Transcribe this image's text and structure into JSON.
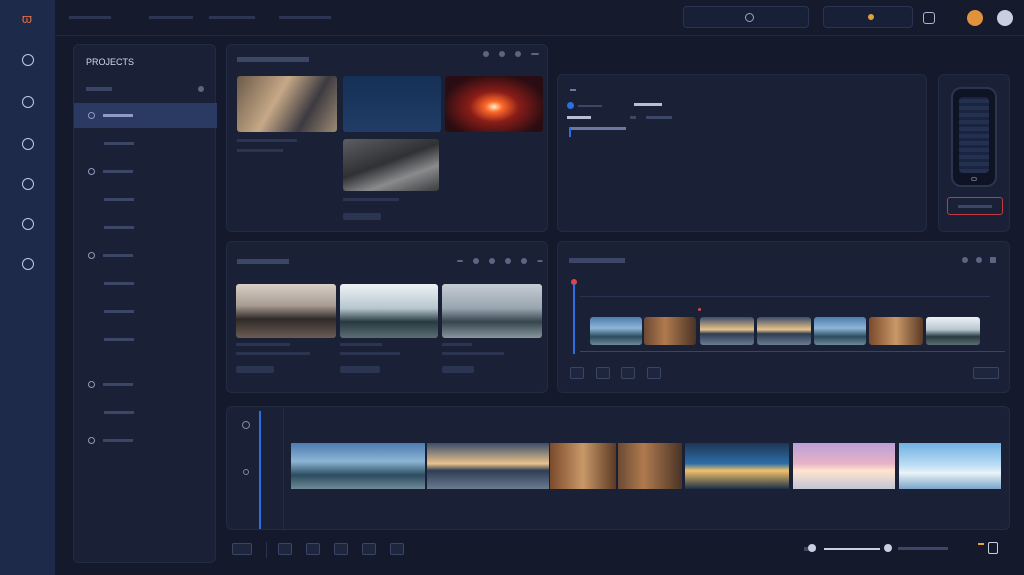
{
  "app": {
    "logo_glyph": "ϖ"
  },
  "rail": {
    "items": [
      {
        "icon": "home-icon"
      },
      {
        "icon": "library-icon"
      },
      {
        "icon": "media-icon"
      },
      {
        "icon": "edit-icon"
      },
      {
        "icon": "effects-icon"
      },
      {
        "icon": "export-icon"
      }
    ]
  },
  "topbar": {
    "search_button": "",
    "profile_button": ""
  },
  "sidebar": {
    "title": "PROJECTS",
    "items": [
      {
        "label": "",
        "active": true,
        "child": false
      },
      {
        "label": "",
        "active": false,
        "child": true
      },
      {
        "label": "",
        "active": false,
        "child": false
      },
      {
        "label": "",
        "active": false,
        "child": true
      },
      {
        "label": "",
        "active": false,
        "child": true
      },
      {
        "label": "",
        "active": false,
        "child": false
      },
      {
        "label": "",
        "active": false,
        "child": true
      },
      {
        "label": "",
        "active": false,
        "child": true
      },
      {
        "label": "",
        "active": false,
        "child": true
      },
      {
        "label": "",
        "active": false,
        "child": false
      },
      {
        "label": "",
        "active": false,
        "child": true
      },
      {
        "label": "",
        "active": false,
        "child": false
      }
    ]
  },
  "colors": {
    "accent": "#2a3a63",
    "playhead": "#2f6ee0",
    "marker": "#e04545"
  }
}
